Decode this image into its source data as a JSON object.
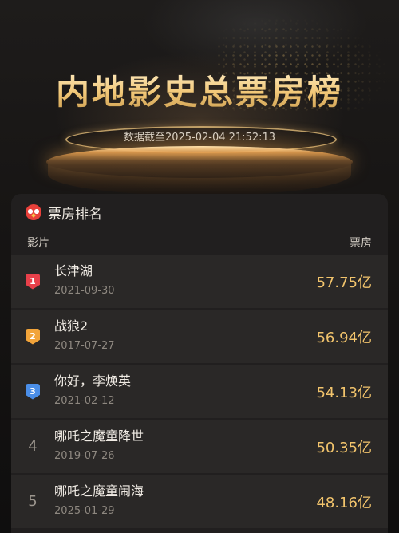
{
  "hero": {
    "title": "内地影史总票房榜",
    "subtitle": "数据截至2025-02-04 21:52:13"
  },
  "panel": {
    "title": "票房排名",
    "icon": "owl-logo-icon",
    "col_film": "影片",
    "col_gross": "票房"
  },
  "colors": {
    "gold": "#f2c46c",
    "rank1": "#e8404a",
    "rank2": "#f2a43a",
    "rank3": "#4a8ee8",
    "panel_bg": "#211f1f",
    "row_bg": "#2a2827"
  },
  "rankings": [
    {
      "rank": "1",
      "title": "长津湖",
      "date": "2021-09-30",
      "gross": "57.75亿"
    },
    {
      "rank": "2",
      "title": "战狼2",
      "date": "2017-07-27",
      "gross": "56.94亿"
    },
    {
      "rank": "3",
      "title": "你好，李焕英",
      "date": "2021-02-12",
      "gross": "54.13亿"
    },
    {
      "rank": "4",
      "title": "哪吒之魔童降世",
      "date": "2019-07-26",
      "gross": "50.35亿"
    },
    {
      "rank": "5",
      "title": "哪吒之魔童闹海",
      "date": "2025-01-29",
      "gross": "48.16亿"
    }
  ]
}
